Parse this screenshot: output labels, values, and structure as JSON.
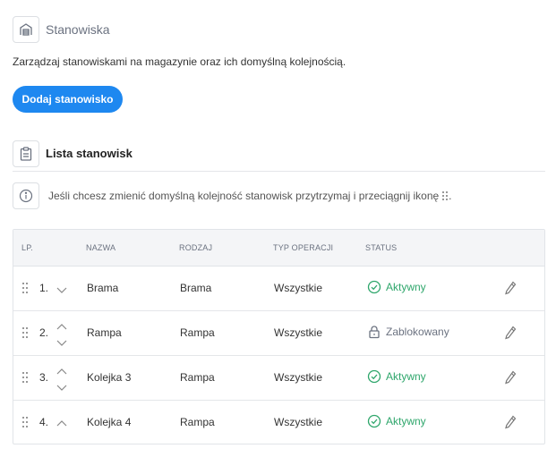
{
  "header": {
    "title": "Stanowiska",
    "description": "Zarządzaj stanowiskami na magazynie oraz ich domyślną kolejnością.",
    "add_button_label": "Dodaj stanowisko"
  },
  "list": {
    "title": "Lista stanowisk",
    "hint": "Jeśli chcesz zmienić domyślną kolejność stanowisk przytrzymaj i przeciągnij ikonę",
    "hint_suffix": ".",
    "columns": {
      "lp": "LP.",
      "name": "NAZWA",
      "type": "RODZAJ",
      "operation": "TYP OPERACJI",
      "status": "STATUS"
    },
    "rows": [
      {
        "lp": "1.",
        "name": "Brama",
        "type": "Brama",
        "operation": "Wszystkie",
        "status": "Aktywny"
      },
      {
        "lp": "2.",
        "name": "Rampa",
        "type": "Rampa",
        "operation": "Wszystkie",
        "status": "Zablokowany"
      },
      {
        "lp": "3.",
        "name": "Kolejka 3",
        "type": "Rampa",
        "operation": "Wszystkie",
        "status": "Aktywny"
      },
      {
        "lp": "4.",
        "name": "Kolejka 4",
        "type": "Rampa",
        "operation": "Wszystkie",
        "status": "Aktywny"
      }
    ]
  },
  "colors": {
    "primary": "#1e88f0",
    "active": "#2ea66b",
    "blocked": "#6b7280"
  },
  "icons": {
    "header": "warehouse-icon",
    "list": "clipboard-icon",
    "hint": "info-icon",
    "drag": "drag-handle-icon",
    "edit": "pencil-icon",
    "active_status": "check-circle-icon",
    "blocked_status": "lock-icon"
  }
}
